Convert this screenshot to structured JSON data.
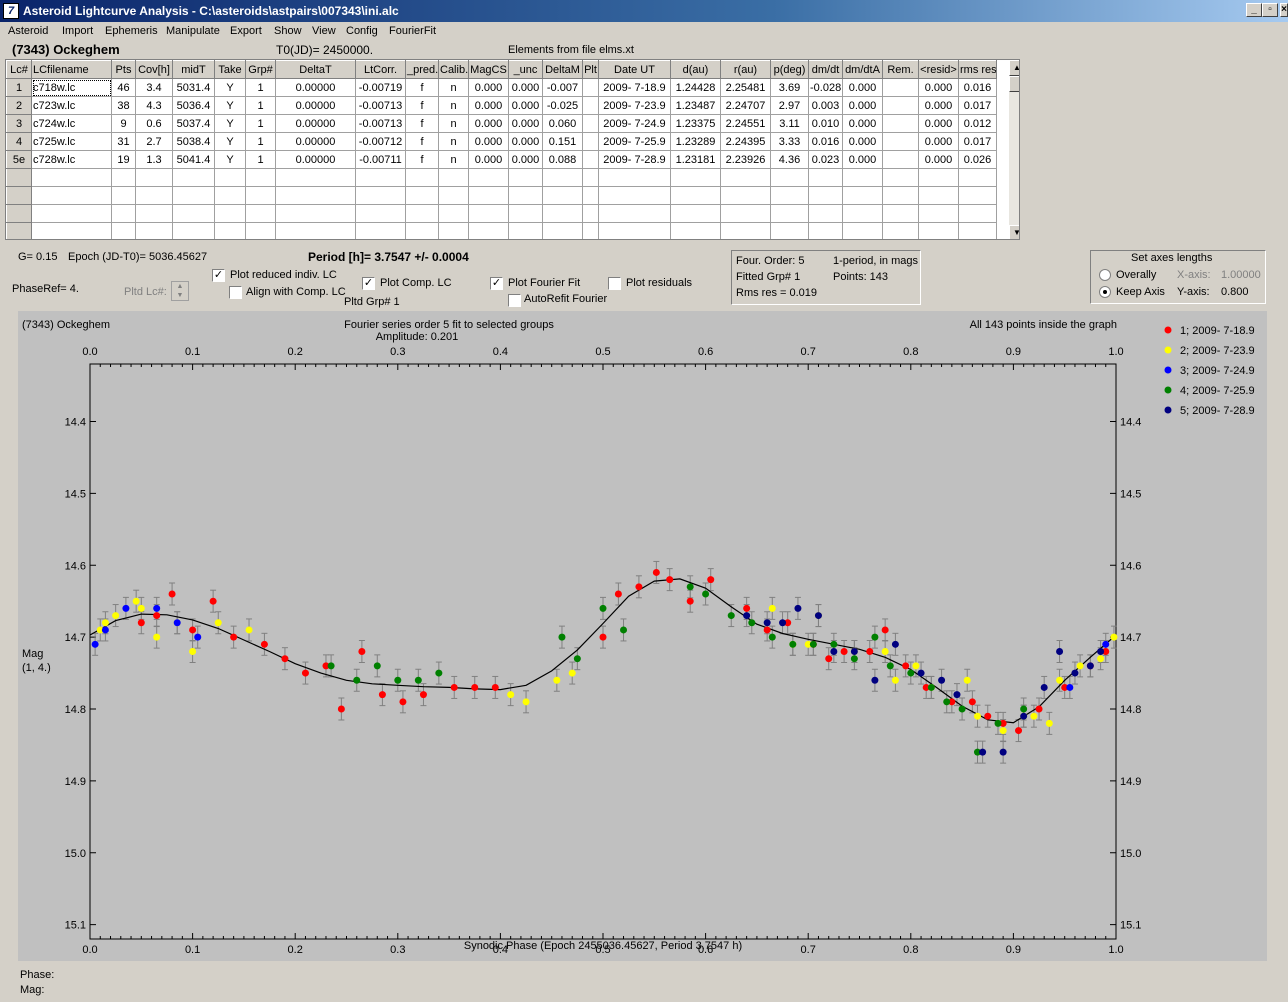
{
  "window": {
    "title": "Asteroid Lightcurve Analysis - C:\\asteroids\\astpairs\\007343\\ini.alc",
    "app_icon": "7"
  },
  "menu": [
    "Asteroid",
    "Import",
    "Ephemeris",
    "Manipulate",
    "Export",
    "Show",
    "View",
    "Config",
    "FourierFit"
  ],
  "header": {
    "asteroid": "(7343) Ockeghem",
    "t0": "T0(JD)= 2450000.",
    "elements": "Elements from file elms.xt"
  },
  "grid": {
    "columns": [
      "Lc#",
      "LCfilename",
      "Pts",
      "Cov[h]",
      "midT",
      "Take",
      "Grp#",
      "DeltaT",
      "LtCorr.",
      "_pred.",
      "Calib.",
      "MagCS",
      "_unc",
      "DeltaM",
      "Plt",
      "Date UT",
      "d(au)",
      "r(au)",
      "p(deg)",
      "dm/dt",
      "dm/dtA",
      "Rem.",
      "<resid>",
      "rms res"
    ],
    "rows": [
      [
        "1",
        "c718w.lc",
        "46",
        "3.4",
        "5031.4",
        "Y",
        "1",
        "0.00000",
        "-0.00719",
        "f",
        "n",
        "0.000",
        "0.000",
        "-0.007",
        "",
        "2009- 7-18.9",
        "1.24428",
        "2.25481",
        "3.69",
        "-0.028",
        "0.000",
        "",
        "0.000",
        "0.016"
      ],
      [
        "2",
        "c723w.lc",
        "38",
        "4.3",
        "5036.4",
        "Y",
        "1",
        "0.00000",
        "-0.00713",
        "f",
        "n",
        "0.000",
        "0.000",
        "-0.025",
        "",
        "2009- 7-23.9",
        "1.23487",
        "2.24707",
        "2.97",
        "0.003",
        "0.000",
        "",
        "0.000",
        "0.017"
      ],
      [
        "3",
        "c724w.lc",
        "9",
        "0.6",
        "5037.4",
        "Y",
        "1",
        "0.00000",
        "-0.00713",
        "f",
        "n",
        "0.000",
        "0.000",
        "0.060",
        "",
        "2009- 7-24.9",
        "1.23375",
        "2.24551",
        "3.11",
        "0.010",
        "0.000",
        "",
        "0.000",
        "0.012"
      ],
      [
        "4",
        "c725w.lc",
        "31",
        "2.7",
        "5038.4",
        "Y",
        "1",
        "0.00000",
        "-0.00712",
        "f",
        "n",
        "0.000",
        "0.000",
        "0.151",
        "",
        "2009- 7-25.9",
        "1.23289",
        "2.24395",
        "3.33",
        "0.016",
        "0.000",
        "",
        "0.000",
        "0.017"
      ],
      [
        "5e",
        "c728w.lc",
        "19",
        "1.3",
        "5041.4",
        "Y",
        "1",
        "0.00000",
        "-0.00711",
        "f",
        "n",
        "0.000",
        "0.000",
        "0.088",
        "",
        "2009- 7-28.9",
        "1.23181",
        "2.23926",
        "4.36",
        "0.023",
        "0.000",
        "",
        "0.000",
        "0.026"
      ]
    ],
    "empty_rows": 4
  },
  "controls": {
    "g_value": "G= 0.15",
    "epoch": "Epoch (JD-T0)= 5036.45627",
    "period": "Period [h]= 3.7547 +/- 0.0004",
    "phase_ref": "PhaseRef= 4.",
    "pltd_lc": "Pltd Lc#:",
    "pltd_grp": "Pltd Grp#  1",
    "plot_reduced": "Plot reduced indiv. LC",
    "align_comp": "Align with Comp. LC",
    "plot_comp": "Plot Comp. LC",
    "plot_fourier": "Plot Fourier Fit",
    "plot_residuals": "Plot residuals",
    "autorefit": "AutoRefit Fourier"
  },
  "fourier_info": {
    "order": "Four. Order:  5",
    "period_note": "1-period, in mags",
    "fitted": "Fitted Grp# 1",
    "points": "Points: 143",
    "rms": "Rms res      = 0.019"
  },
  "axes_panel": {
    "title": "Set axes lengths",
    "overall": "Overally",
    "keep": "Keep Axis",
    "x_label": "X-axis:",
    "x_val": "1.00000",
    "y_label": "Y-axis:",
    "y_val": "0.800"
  },
  "plot": {
    "top_left": "(7343) Ockeghem",
    "top_center1": "Fourier series order 5 fit to selected groups",
    "top_center2": "Amplitude: 0.201",
    "top_right": "All 143 points inside the graph",
    "ylabel1": "Mag",
    "ylabel2": "(1, 4.)",
    "xlabel": "Synodic Phase (Epoch 2455036.45627, Period 3.7547 h)"
  },
  "chart_data": {
    "type": "scatter",
    "title": "Fourier series order 5 fit to selected groups",
    "xlabel": "Synodic Phase (Epoch 2455036.45627, Period 3.7547 h)",
    "ylabel": "Mag (1, 4.)",
    "xlim": [
      0,
      1
    ],
    "ylim": [
      15.12,
      14.32
    ],
    "x_ticks": [
      "0.0",
      "0.1",
      "0.2",
      "0.3",
      "0.4",
      "0.5",
      "0.6",
      "0.7",
      "0.8",
      "0.9",
      "1.0"
    ],
    "y_ticks": [
      "14.4",
      "14.5",
      "14.6",
      "14.7",
      "14.8",
      "14.9",
      "15.0",
      "15.1"
    ],
    "legend_position": "right",
    "series": [
      {
        "name": "1; 2009- 7-18.9",
        "color": "#ff0000",
        "points": [
          [
            0.05,
            14.68
          ],
          [
            0.065,
            14.67
          ],
          [
            0.08,
            14.64
          ],
          [
            0.1,
            14.69
          ],
          [
            0.12,
            14.65
          ],
          [
            0.14,
            14.7
          ],
          [
            0.17,
            14.71
          ],
          [
            0.19,
            14.73
          ],
          [
            0.21,
            14.75
          ],
          [
            0.23,
            14.74
          ],
          [
            0.245,
            14.8
          ],
          [
            0.265,
            14.72
          ],
          [
            0.285,
            14.78
          ],
          [
            0.305,
            14.79
          ],
          [
            0.325,
            14.78
          ],
          [
            0.355,
            14.77
          ],
          [
            0.375,
            14.77
          ],
          [
            0.395,
            14.77
          ],
          [
            0.5,
            14.7
          ],
          [
            0.515,
            14.64
          ],
          [
            0.535,
            14.63
          ],
          [
            0.552,
            14.61
          ],
          [
            0.565,
            14.62
          ],
          [
            0.585,
            14.65
          ],
          [
            0.605,
            14.62
          ],
          [
            0.64,
            14.66
          ],
          [
            0.66,
            14.69
          ],
          [
            0.68,
            14.68
          ],
          [
            0.705,
            14.71
          ],
          [
            0.72,
            14.73
          ],
          [
            0.735,
            14.72
          ],
          [
            0.76,
            14.72
          ],
          [
            0.775,
            14.69
          ],
          [
            0.795,
            14.74
          ],
          [
            0.815,
            14.77
          ],
          [
            0.84,
            14.79
          ],
          [
            0.86,
            14.79
          ],
          [
            0.875,
            14.81
          ],
          [
            0.89,
            14.82
          ],
          [
            0.905,
            14.83
          ],
          [
            0.925,
            14.8
          ],
          [
            0.95,
            14.77
          ],
          [
            0.975,
            14.74
          ],
          [
            0.99,
            14.72
          ]
        ]
      },
      {
        "name": "2; 2009- 7-23.9",
        "color": "#ffff00",
        "points": [
          [
            0.01,
            14.69
          ],
          [
            0.015,
            14.68
          ],
          [
            0.025,
            14.67
          ],
          [
            0.045,
            14.65
          ],
          [
            0.05,
            14.66
          ],
          [
            0.065,
            14.7
          ],
          [
            0.085,
            14.68
          ],
          [
            0.1,
            14.72
          ],
          [
            0.125,
            14.68
          ],
          [
            0.155,
            14.69
          ],
          [
            0.41,
            14.78
          ],
          [
            0.425,
            14.79
          ],
          [
            0.455,
            14.76
          ],
          [
            0.47,
            14.75
          ],
          [
            0.665,
            14.66
          ],
          [
            0.685,
            14.71
          ],
          [
            0.7,
            14.71
          ],
          [
            0.71,
            14.67
          ],
          [
            0.745,
            14.72
          ],
          [
            0.775,
            14.72
          ],
          [
            0.785,
            14.76
          ],
          [
            0.805,
            14.74
          ],
          [
            0.82,
            14.77
          ],
          [
            0.855,
            14.76
          ],
          [
            0.865,
            14.81
          ],
          [
            0.89,
            14.83
          ],
          [
            0.91,
            14.81
          ],
          [
            0.92,
            14.81
          ],
          [
            0.935,
            14.82
          ],
          [
            0.945,
            14.76
          ],
          [
            0.965,
            14.74
          ],
          [
            0.985,
            14.73
          ],
          [
            0.998,
            14.7
          ]
        ]
      },
      {
        "name": "3; 2009- 7-24.9",
        "color": "#0000ff",
        "points": [
          [
            0.005,
            14.71
          ],
          [
            0.015,
            14.69
          ],
          [
            0.035,
            14.66
          ],
          [
            0.065,
            14.66
          ],
          [
            0.085,
            14.68
          ],
          [
            0.105,
            14.7
          ],
          [
            0.955,
            14.77
          ],
          [
            0.99,
            14.71
          ]
        ]
      },
      {
        "name": "4; 2009- 7-25.9",
        "color": "#008000",
        "points": [
          [
            0.235,
            14.74
          ],
          [
            0.26,
            14.76
          ],
          [
            0.28,
            14.74
          ],
          [
            0.3,
            14.76
          ],
          [
            0.32,
            14.76
          ],
          [
            0.34,
            14.75
          ],
          [
            0.46,
            14.7
          ],
          [
            0.475,
            14.73
          ],
          [
            0.5,
            14.66
          ],
          [
            0.52,
            14.69
          ],
          [
            0.585,
            14.63
          ],
          [
            0.6,
            14.64
          ],
          [
            0.625,
            14.67
          ],
          [
            0.645,
            14.68
          ],
          [
            0.665,
            14.7
          ],
          [
            0.685,
            14.71
          ],
          [
            0.705,
            14.71
          ],
          [
            0.725,
            14.71
          ],
          [
            0.745,
            14.73
          ],
          [
            0.765,
            14.7
          ],
          [
            0.78,
            14.74
          ],
          [
            0.8,
            14.75
          ],
          [
            0.82,
            14.77
          ],
          [
            0.835,
            14.79
          ],
          [
            0.85,
            14.8
          ],
          [
            0.865,
            14.86
          ],
          [
            0.885,
            14.82
          ],
          [
            0.91,
            14.8
          ]
        ]
      },
      {
        "name": "5; 2009- 7-28.9",
        "color": "#000080",
        "points": [
          [
            0.64,
            14.67
          ],
          [
            0.66,
            14.68
          ],
          [
            0.675,
            14.68
          ],
          [
            0.69,
            14.66
          ],
          [
            0.71,
            14.67
          ],
          [
            0.725,
            14.72
          ],
          [
            0.745,
            14.72
          ],
          [
            0.765,
            14.76
          ],
          [
            0.785,
            14.71
          ],
          [
            0.81,
            14.75
          ],
          [
            0.83,
            14.76
          ],
          [
            0.845,
            14.78
          ],
          [
            0.87,
            14.86
          ],
          [
            0.89,
            14.86
          ],
          [
            0.91,
            14.81
          ],
          [
            0.93,
            14.77
          ],
          [
            0.945,
            14.72
          ],
          [
            0.96,
            14.75
          ],
          [
            0.975,
            14.74
          ],
          [
            0.985,
            14.72
          ]
        ]
      }
    ],
    "fit_curve": [
      [
        0,
        14.697
      ],
      [
        0.025,
        14.677
      ],
      [
        0.05,
        14.668
      ],
      [
        0.075,
        14.669
      ],
      [
        0.1,
        14.676
      ],
      [
        0.125,
        14.688
      ],
      [
        0.15,
        14.704
      ],
      [
        0.175,
        14.72
      ],
      [
        0.2,
        14.737
      ],
      [
        0.225,
        14.75
      ],
      [
        0.25,
        14.76
      ],
      [
        0.275,
        14.765
      ],
      [
        0.3,
        14.767
      ],
      [
        0.325,
        14.769
      ],
      [
        0.35,
        14.77
      ],
      [
        0.375,
        14.772
      ],
      [
        0.4,
        14.773
      ],
      [
        0.425,
        14.767
      ],
      [
        0.45,
        14.747
      ],
      [
        0.475,
        14.718
      ],
      [
        0.5,
        14.681
      ],
      [
        0.525,
        14.643
      ],
      [
        0.55,
        14.622
      ],
      [
        0.575,
        14.619
      ],
      [
        0.6,
        14.632
      ],
      [
        0.625,
        14.658
      ],
      [
        0.65,
        14.682
      ],
      [
        0.675,
        14.695
      ],
      [
        0.7,
        14.703
      ],
      [
        0.725,
        14.71
      ],
      [
        0.75,
        14.717
      ],
      [
        0.775,
        14.728
      ],
      [
        0.8,
        14.745
      ],
      [
        0.825,
        14.77
      ],
      [
        0.85,
        14.796
      ],
      [
        0.875,
        14.815
      ],
      [
        0.9,
        14.819
      ],
      [
        0.925,
        14.797
      ],
      [
        0.95,
        14.76
      ],
      [
        0.975,
        14.728
      ],
      [
        1.0,
        14.697
      ]
    ]
  },
  "status": {
    "phase": "Phase:",
    "mag": "Mag:"
  }
}
